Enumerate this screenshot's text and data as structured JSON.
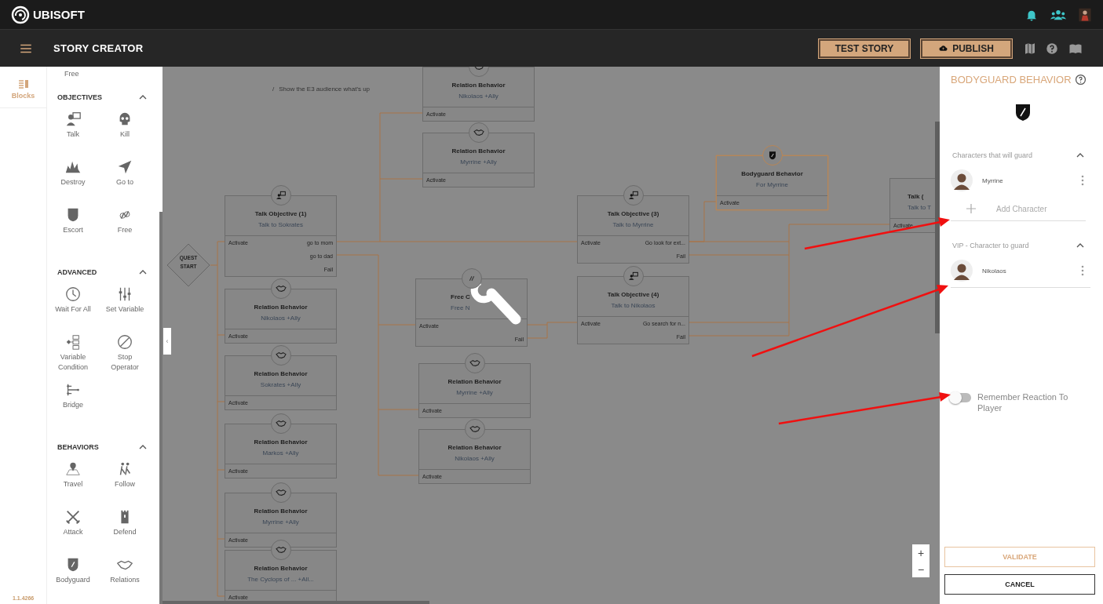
{
  "app": {
    "logo": "UBISOFT",
    "title": "STORY CREATOR"
  },
  "toolbar": {
    "buttons": [
      "TEST STORY",
      "PUBLISH"
    ]
  },
  "rail": {
    "tabs": [
      {
        "label": "Blocks",
        "selected": true
      }
    ],
    "version": "1.1.4266"
  },
  "palette": {
    "top_items": [
      "Free"
    ],
    "sections": [
      {
        "title": "OBJECTIVES",
        "expanded": true,
        "items": [
          "Talk",
          "Kill",
          "Destroy",
          "Go to",
          "Escort",
          "Free"
        ]
      },
      {
        "title": "ADVANCED",
        "expanded": true,
        "items": [
          "Wait For All",
          "Set Variable",
          "Variable Condition",
          "Stop Operator",
          "Bridge"
        ]
      },
      {
        "title": "BEHAVIORS",
        "expanded": true,
        "items": [
          "Travel",
          "Follow",
          "Attack",
          "Defend",
          "Bodyguard",
          "Relations"
        ]
      }
    ]
  },
  "breadcrumb": {
    "separator": "/",
    "current": "Show the E3 audience what's up"
  },
  "canvas": {
    "start": [
      "QUEST",
      "START"
    ],
    "collapse_button": "‹",
    "zoom_buttons": [
      "+",
      "−"
    ],
    "nodes": [
      {
        "kind": "relation",
        "title": "Relation Behavior",
        "subtitle": "Nikolaos +Ally",
        "input": "Activate",
        "selected": false
      },
      {
        "kind": "relation",
        "title": "Relation Behavior",
        "subtitle": "Myrrine +Ally",
        "input": "Activate",
        "selected": false
      },
      {
        "kind": "talk",
        "title": "Talk Objective (1)",
        "subtitle": "Talk to Sokrates",
        "input": "Activate",
        "outputs": [
          "go to mom",
          "go to dad",
          "Fail"
        ],
        "selected": false
      },
      {
        "kind": "relation",
        "title": "Relation Behavior",
        "subtitle": "Nikolaos +Ally",
        "input": "Activate",
        "selected": false
      },
      {
        "kind": "relation",
        "title": "Relation Behavior",
        "subtitle": "Sokrates +Ally",
        "input": "Activate",
        "selected": false
      },
      {
        "kind": "relation",
        "title": "Relation Behavior",
        "subtitle": "Markos +Ally",
        "input": "Activate",
        "selected": false
      },
      {
        "kind": "relation",
        "title": "Relation Behavior",
        "subtitle": "Myrrine +Ally",
        "input": "Activate",
        "selected": false
      },
      {
        "kind": "relation",
        "title": "Relation Behavior",
        "subtitle": "The Cyclops of ... +All...",
        "input": "Activate",
        "selected": false
      },
      {
        "kind": "free",
        "title": "Free C",
        "subtitle": "Free N",
        "input": "Activate",
        "outputs": [
          "Fail"
        ],
        "selected": false
      },
      {
        "kind": "relation",
        "title": "Relation Behavior",
        "subtitle": "Myrrine +Ally",
        "input": "Activate",
        "selected": false
      },
      {
        "kind": "relation",
        "title": "Relation Behavior",
        "subtitle": "Nikolaos +Ally",
        "input": "Activate",
        "selected": false
      },
      {
        "kind": "talk",
        "title": "Talk Objective (3)",
        "subtitle": "Talk to Myrrine",
        "input": "Activate",
        "outputs": [
          "Go look for ext...",
          "Fail"
        ],
        "selected": false
      },
      {
        "kind": "talk",
        "title": "Talk Objective (4)",
        "subtitle": "Talk to Nikolaos",
        "input": "Activate",
        "outputs": [
          "Go search for n...",
          "Fail"
        ],
        "selected": false
      },
      {
        "kind": "bodyguard",
        "title": "Bodyguard Behavior",
        "subtitle": "For Myrrine",
        "input": "Activate",
        "selected": true
      },
      {
        "kind": "plain",
        "title": "Talk (",
        "subtitle": "Talk to T",
        "input": "Activate",
        "selected": false
      }
    ]
  },
  "panel": {
    "title": "BODYGUARD BEHAVIOR",
    "sections": [
      {
        "title": "Characters that will guard",
        "expanded": true,
        "characters": [
          "Myrrine"
        ],
        "add_label": "Add Character"
      },
      {
        "title": "VIP - Character to guard",
        "expanded": true,
        "characters": [
          "Nikolaos"
        ]
      }
    ],
    "toggle": {
      "label": "Remember Reaction To Player",
      "on": false
    },
    "buttons": [
      "VALIDATE",
      "CANCEL"
    ]
  }
}
